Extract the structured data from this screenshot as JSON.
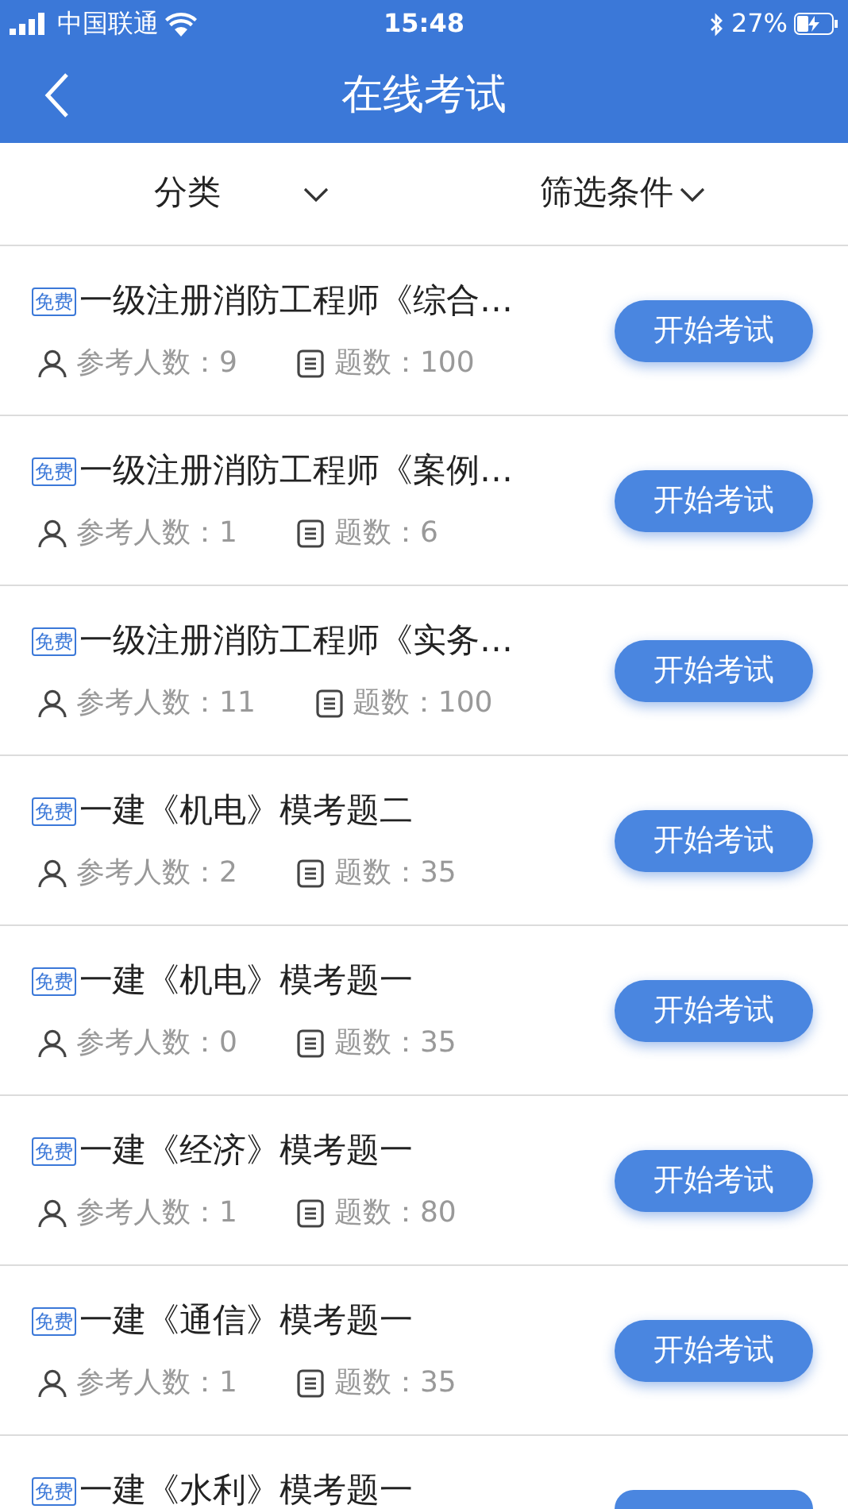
{
  "status_bar": {
    "carrier": "中国联通",
    "time": "15:48",
    "battery": "27%"
  },
  "header": {
    "title": "在线考试"
  },
  "filters": [
    {
      "label": "分类"
    },
    {
      "label": "筛选条件"
    }
  ],
  "exams": [
    {
      "badge": "免费",
      "title": "一级注册消防工程师《综合…",
      "participants": "参考人数：9",
      "questions": "题数：100",
      "button": "开始考试"
    },
    {
      "badge": "免费",
      "title": "一级注册消防工程师《案例…",
      "participants": "参考人数：1",
      "questions": "题数：6",
      "button": "开始考试"
    },
    {
      "badge": "免费",
      "title": "一级注册消防工程师《实务…",
      "participants": "参考人数：11",
      "questions": "题数：100",
      "button": "开始考试"
    },
    {
      "badge": "免费",
      "title": "一建《机电》模考题二",
      "participants": "参考人数：2",
      "questions": "题数：35",
      "button": "开始考试"
    },
    {
      "badge": "免费",
      "title": "一建《机电》模考题一",
      "participants": "参考人数：0",
      "questions": "题数：35",
      "button": "开始考试"
    },
    {
      "badge": "免费",
      "title": "一建《经济》模考题一",
      "participants": "参考人数：1",
      "questions": "题数：80",
      "button": "开始考试"
    },
    {
      "badge": "免费",
      "title": "一建《通信》模考题一",
      "participants": "参考人数：1",
      "questions": "题数：35",
      "button": "开始考试"
    },
    {
      "badge": "免费",
      "title": "一建《水利》模考题一"
    }
  ]
}
